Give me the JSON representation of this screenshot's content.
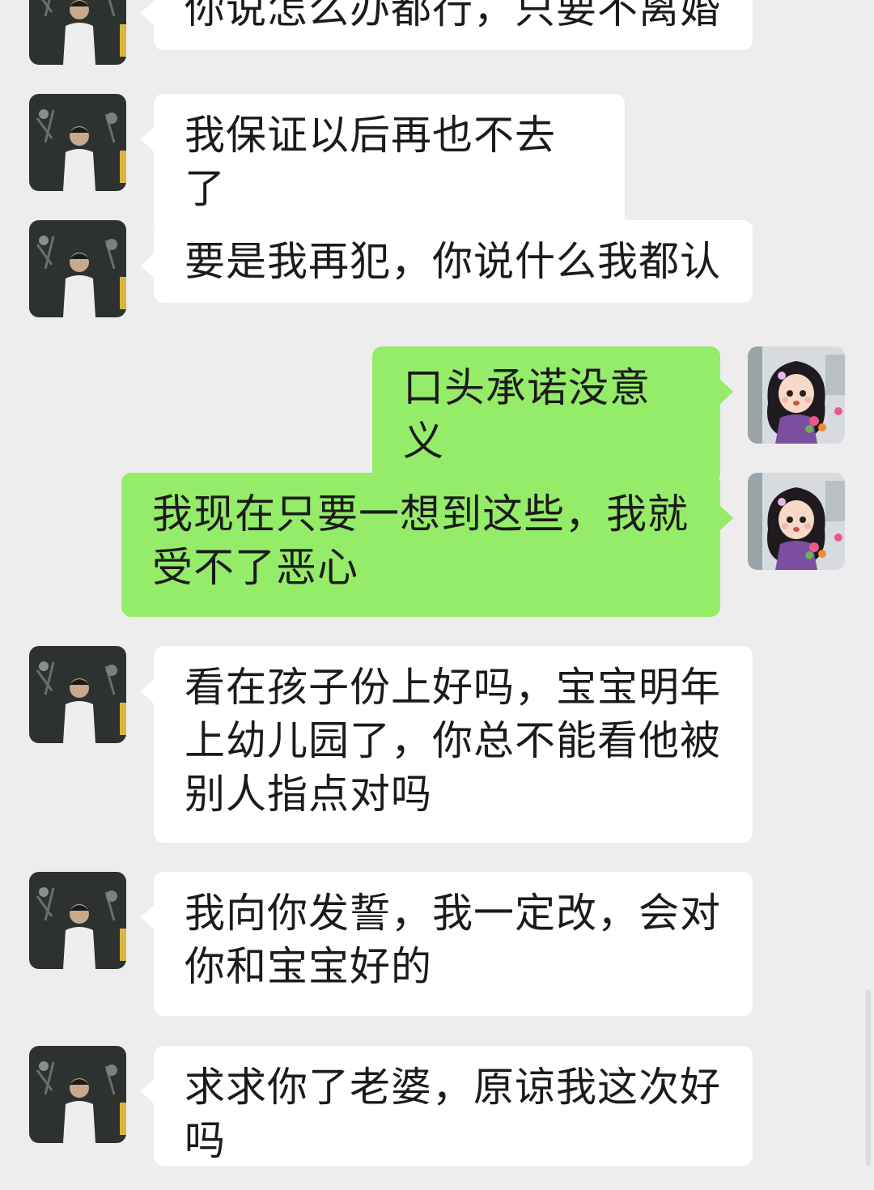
{
  "conversation": {
    "messages": [
      {
        "side": "in",
        "text": "你说怎么办都行，只要不离婚"
      },
      {
        "side": "in",
        "text": "我保证以后再也不去了"
      },
      {
        "side": "in",
        "text": "要是我再犯，你说什么我都认"
      },
      {
        "side": "out",
        "text": "口头承诺没意义"
      },
      {
        "side": "out",
        "text": "我现在只要一想到这些，我就受不了恶心"
      },
      {
        "side": "in",
        "text": "看在孩子份上好吗，宝宝明年上幼儿园了，你总不能看他被别人指点对吗"
      },
      {
        "side": "in",
        "text": "我向你发誓，我一定改，会对你和宝宝好的"
      },
      {
        "side": "in",
        "text": "求求你了老婆，原谅我这次好吗"
      }
    ]
  },
  "colors": {
    "background": "#ededed",
    "incoming_bubble": "#ffffff",
    "outgoing_bubble": "#95ec69",
    "text": "#1b1b1b"
  },
  "icons": {
    "contact_avatar": "avatar-photo-boy",
    "self_avatar": "avatar-cartoon-girl"
  }
}
